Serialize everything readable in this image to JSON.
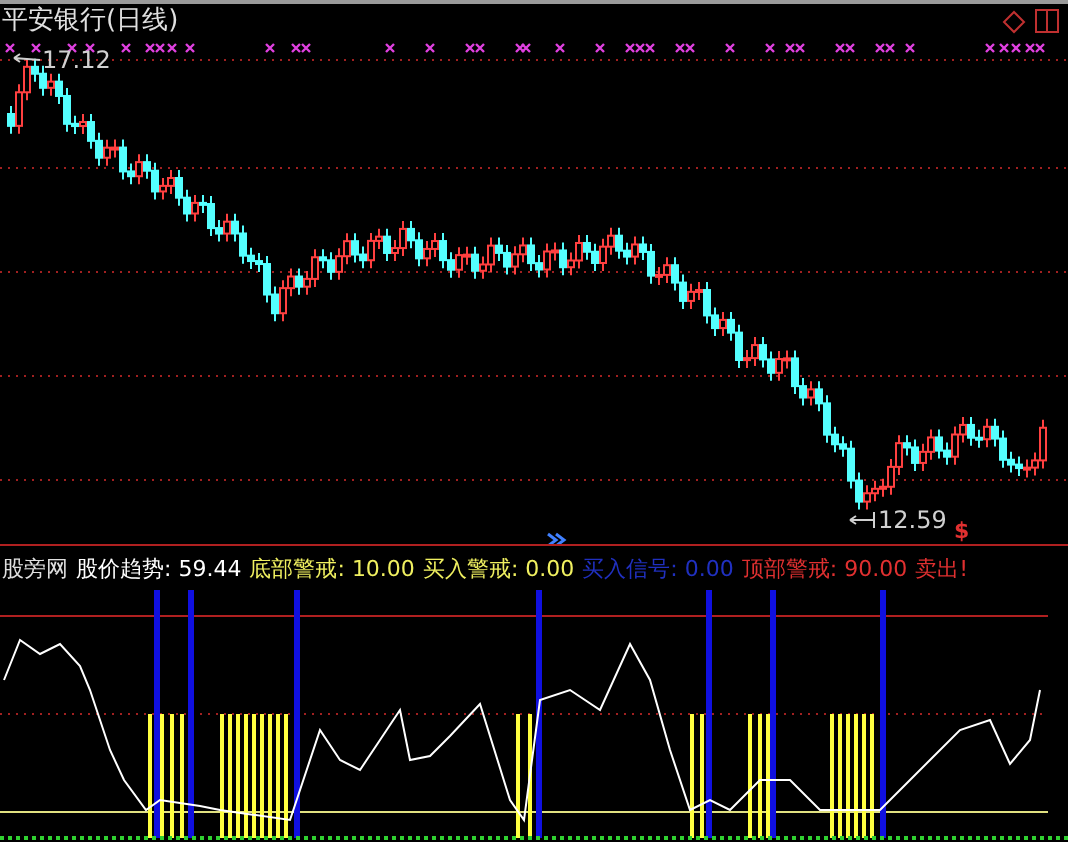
{
  "chart_title": "平安银行(日线)",
  "price_labels": [
    {
      "kind": "high",
      "text": "17.12"
    },
    {
      "kind": "low",
      "text": "12.59"
    }
  ],
  "sell_marker": "$",
  "indicator_name": "股旁网",
  "indicators": [
    {
      "label": "股价趋势:",
      "value": "59.44",
      "color": "#ffffff"
    },
    {
      "label": "底部警戒:",
      "value": "10.00",
      "color": "#f0f060"
    },
    {
      "label": "买入警戒:",
      "value": "0.00",
      "color": "#f0f060"
    },
    {
      "label": "买入信号:",
      "value": "0.00",
      "color": "#2030c0"
    },
    {
      "label": "顶部警戒:",
      "value": "90.00",
      "color": "#e03030"
    }
  ],
  "sell_signal": {
    "text": "卖出!",
    "color": "#e03030"
  }
}
